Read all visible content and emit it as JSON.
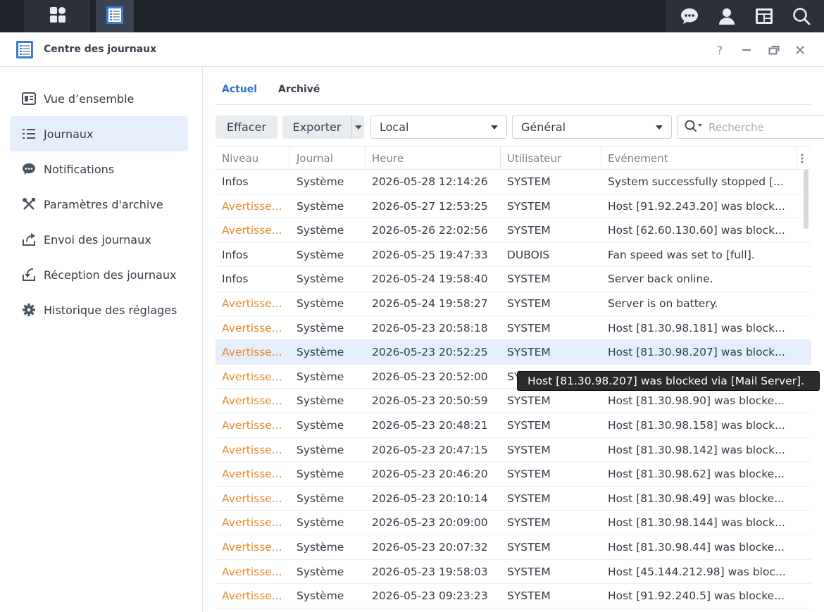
{
  "app": {
    "title": "Centre des journaux"
  },
  "taskbar": {
    "main_menu_icon": "grid-icon",
    "app_icon": "log-center-icon",
    "right_icons": [
      "chat-icon",
      "user-icon",
      "widgets-icon",
      "search-icon"
    ]
  },
  "window_controls": {
    "help": "?"
  },
  "sidebar": {
    "items": [
      {
        "label": "Vue d’ensemble",
        "icon": "overview-icon"
      },
      {
        "label": "Journaux",
        "icon": "list-icon",
        "active": true
      },
      {
        "label": "Notifications",
        "icon": "chat-bubble-icon"
      },
      {
        "label": "Paramètres d'archive",
        "icon": "tools-icon"
      },
      {
        "label": "Envoi des journaux",
        "icon": "upload-icon"
      },
      {
        "label": "Réception des journaux",
        "icon": "download-icon"
      },
      {
        "label": "Historique des réglages",
        "icon": "gear-icon"
      }
    ]
  },
  "tabs": [
    {
      "label": "Actuel",
      "active": true
    },
    {
      "label": "Archivé",
      "active": false
    }
  ],
  "toolbar": {
    "clear_label": "Effacer",
    "export_label": "Exporter",
    "source_select": "Local",
    "category_select": "Général",
    "search_placeholder": "Recherche"
  },
  "table": {
    "columns": [
      "Niveau",
      "Journal",
      "Heure",
      "Utilisateur",
      "Evénement"
    ],
    "rows": [
      [
        "Infos",
        "Système",
        "2026-05-28 12:14:26",
        "SYSTEM",
        "System successfully stopped [..."
      ],
      [
        "Avertisse...",
        "Système",
        "2026-05-27 12:53:25",
        "SYSTEM",
        "Host [91.92.243.20] was block..."
      ],
      [
        "Avertisse...",
        "Système",
        "2026-05-26 22:02:56",
        "SYSTEM",
        "Host [62.60.130.60] was block..."
      ],
      [
        "Infos",
        "Système",
        "2026-05-25 19:47:33",
        "DUBOIS",
        "Fan speed was set to [full]."
      ],
      [
        "Infos",
        "Système",
        "2026-05-24 19:58:40",
        "SYSTEM",
        "Server back online."
      ],
      [
        "Avertisse...",
        "Système",
        "2026-05-24 19:58:27",
        "SYSTEM",
        "Server is on battery."
      ],
      [
        "Avertisse...",
        "Système",
        "2026-05-23 20:58:18",
        "SYSTEM",
        "Host [81.30.98.181] was block..."
      ],
      [
        "Avertisse...",
        "Système",
        "2026-05-23 20:52:25",
        "SYSTEM",
        "Host [81.30.98.207] was block..."
      ],
      [
        "Avertisse...",
        "Système",
        "2026-05-23 20:52:00",
        "SY",
        ""
      ],
      [
        "Avertisse...",
        "Système",
        "2026-05-23 20:50:59",
        "SYSTEM",
        "Host [81.30.98.90] was blocke..."
      ],
      [
        "Avertisse...",
        "Système",
        "2026-05-23 20:48:21",
        "SYSTEM",
        "Host [81.30.98.158] was block..."
      ],
      [
        "Avertisse...",
        "Système",
        "2026-05-23 20:47:15",
        "SYSTEM",
        "Host [81.30.98.142] was block..."
      ],
      [
        "Avertisse...",
        "Système",
        "2026-05-23 20:46:20",
        "SYSTEM",
        "Host [81.30.98.62] was blocke..."
      ],
      [
        "Avertisse...",
        "Système",
        "2026-05-23 20:10:14",
        "SYSTEM",
        "Host [81.30.98.49] was blocke..."
      ],
      [
        "Avertisse...",
        "Système",
        "2026-05-23 20:09:00",
        "SYSTEM",
        "Host [81.30.98.144] was block..."
      ],
      [
        "Avertisse...",
        "Système",
        "2026-05-23 20:07:32",
        "SYSTEM",
        "Host [81.30.98.44] was blocke..."
      ],
      [
        "Avertisse...",
        "Système",
        "2026-05-23 19:58:03",
        "SYSTEM",
        "Host [45.144.212.98] was bloc..."
      ],
      [
        "Avertisse...",
        "Système",
        "2026-05-23 09:23:23",
        "SYSTEM",
        "Host [91.92.240.5] was blocke..."
      ]
    ],
    "selected_row": 7
  },
  "tooltip": {
    "text": "Host [81.30.98.207] was blocked via [Mail Server]."
  },
  "colors": {
    "accent": "#2d6fd2",
    "warning": "#e8892e",
    "selection": "#e5eefa"
  }
}
